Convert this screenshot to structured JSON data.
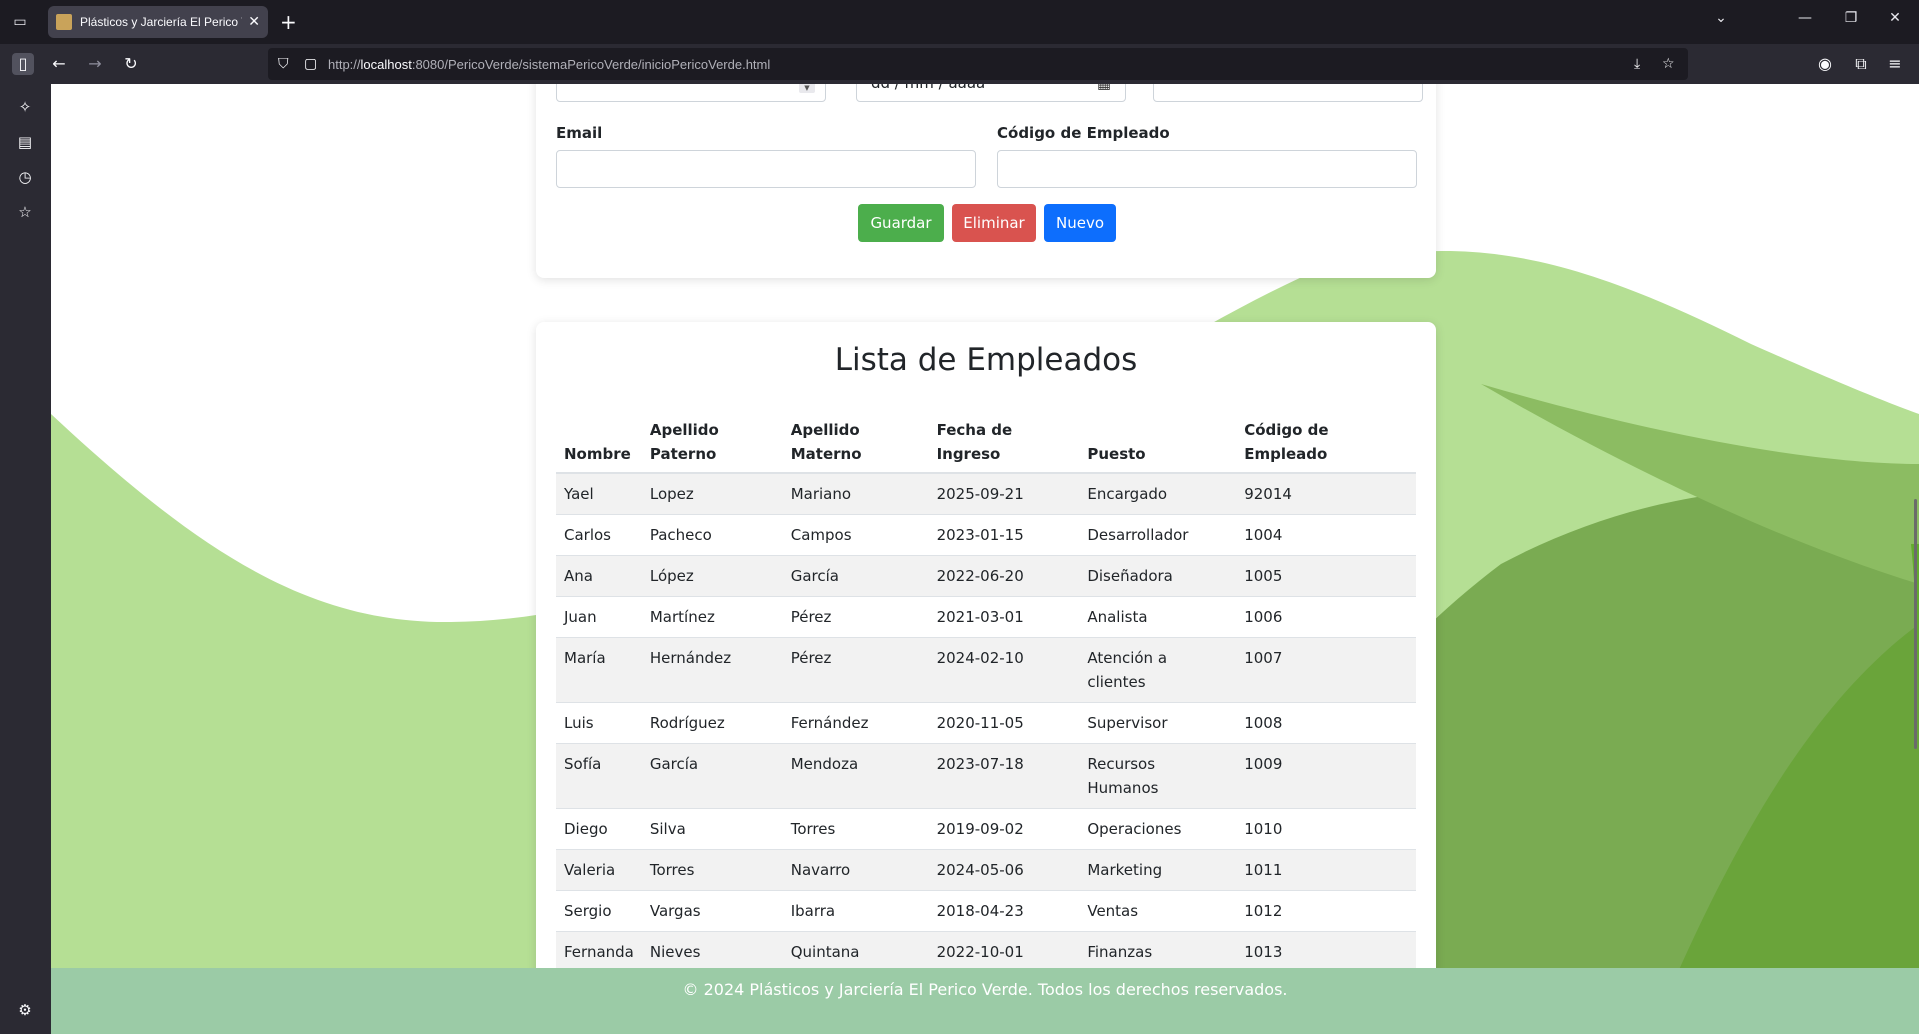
{
  "browser": {
    "tab_title": "Plásticos y Jarciería El Perico Verde",
    "url_prefix": "http://",
    "url_host": "localhost",
    "url_rest": ":8080/PericoVerde/sistemaPericoVerde/inicioPericoVerde.html"
  },
  "form": {
    "date_placeholder": "dd / mm / aaaa",
    "email_label": "Email",
    "code_label": "Código de Empleado",
    "save_label": "Guardar",
    "delete_label": "Eliminar",
    "new_label": "Nuevo"
  },
  "list": {
    "title": "Lista de Empleados",
    "headers": [
      "Nombre",
      "Apellido Paterno",
      "Apellido Materno",
      "Fecha de Ingreso",
      "Puesto",
      "Código de Empleado"
    ],
    "rows": [
      [
        "Yael",
        "Lopez",
        "Mariano",
        "2025-09-21",
        "Encargado",
        "92014"
      ],
      [
        "Carlos",
        "Pacheco",
        "Campos",
        "2023-01-15",
        "Desarrollador",
        "1004"
      ],
      [
        "Ana",
        "López",
        "García",
        "2022-06-20",
        "Diseñadora",
        "1005"
      ],
      [
        "Juan",
        "Martínez",
        "Pérez",
        "2021-03-01",
        "Analista",
        "1006"
      ],
      [
        "María",
        "Hernández",
        "Pérez",
        "2024-02-10",
        "Atención a clientes",
        "1007"
      ],
      [
        "Luis",
        "Rodríguez",
        "Fernández",
        "2020-11-05",
        "Supervisor",
        "1008"
      ],
      [
        "Sofía",
        "García",
        "Mendoza",
        "2023-07-18",
        "Recursos Humanos",
        "1009"
      ],
      [
        "Diego",
        "Silva",
        "Torres",
        "2019-09-02",
        "Operaciones",
        "1010"
      ],
      [
        "Valeria",
        "Torres",
        "Navarro",
        "2024-05-06",
        "Marketing",
        "1011"
      ],
      [
        "Sergio",
        "Vargas",
        "Ibarra",
        "2018-04-23",
        "Ventas",
        "1012"
      ],
      [
        "Fernanda",
        "Nieves",
        "Quintana",
        "2022-10-01",
        "Finanzas",
        "1013"
      ]
    ]
  },
  "footer": {
    "text": "© 2024 Plásticos y Jarciería El Perico Verde. Todos los derechos reservados."
  },
  "colors": {
    "save": "#4cae4c",
    "delete": "#d9534f",
    "new": "#0d6efd",
    "footer": "#9bcba6",
    "wave_light": "#b5df94",
    "wave_mid": "#7aab52",
    "wave_dark": "#63ab2e"
  }
}
